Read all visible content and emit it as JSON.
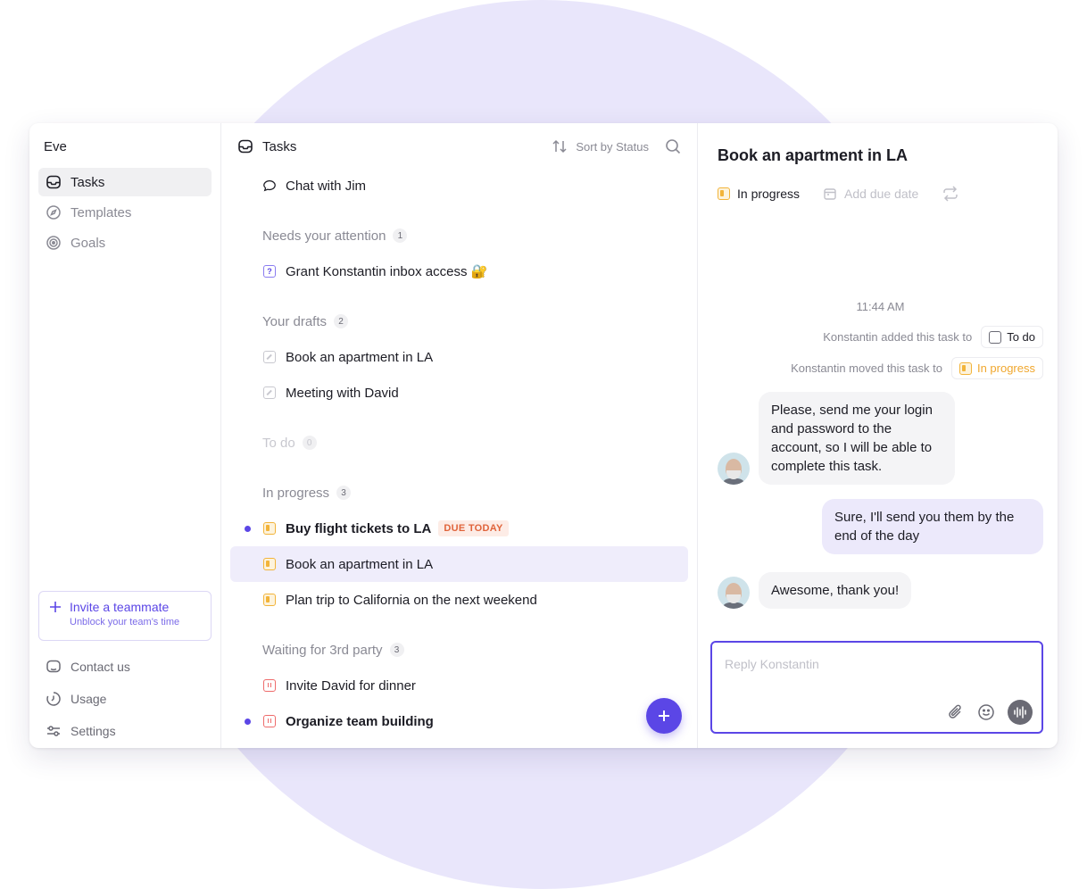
{
  "workspace": "Eve",
  "sidebar": {
    "items": [
      {
        "label": "Tasks",
        "icon": "inbox-icon",
        "active": true
      },
      {
        "label": "Templates",
        "icon": "compass-icon"
      },
      {
        "label": "Goals",
        "icon": "target-icon"
      }
    ],
    "invite": {
      "label": "Invite a teammate",
      "sub": "Unblock your team's time"
    },
    "bottom": [
      {
        "label": "Contact us",
        "icon": "chat-icon"
      },
      {
        "label": "Usage",
        "icon": "clock-icon"
      },
      {
        "label": "Settings",
        "icon": "sliders-icon"
      }
    ]
  },
  "tasks": {
    "title": "Tasks",
    "sort_label": "Sort by Status",
    "chat": "Chat with Jim",
    "sections": [
      {
        "title": "Needs your attention",
        "count": "1",
        "items": [
          {
            "label": "Grant Konstantin inbox access 🔐",
            "status": "question"
          }
        ]
      },
      {
        "title": "Your drafts",
        "count": "2",
        "items": [
          {
            "label": "Book an apartment in LA",
            "status": "draft"
          },
          {
            "label": "Meeting with David",
            "status": "draft"
          }
        ]
      },
      {
        "title": "To do",
        "count": "0",
        "items": []
      },
      {
        "title": "In progress",
        "count": "3",
        "items": [
          {
            "label": "Buy flight tickets to LA",
            "status": "in-progress",
            "badge": "DUE TODAY",
            "unread": true
          },
          {
            "label": "Book an apartment in LA",
            "status": "in-progress",
            "selected": true
          },
          {
            "label": "Plan trip to California on the next weekend",
            "status": "in-progress"
          }
        ]
      },
      {
        "title": "Waiting for 3rd party",
        "count": "3",
        "items": [
          {
            "label": "Invite David for dinner",
            "status": "waiting"
          },
          {
            "label": "Organize team building",
            "status": "waiting",
            "unread": true
          }
        ]
      }
    ]
  },
  "detail": {
    "title": "Book an apartment in LA",
    "status": "In progress",
    "due_date": "Add due date",
    "time": "11:44 AM",
    "activity": [
      {
        "text": "Konstantin added this task to",
        "pill": "To do"
      },
      {
        "text": "Konstantin moved this task to",
        "pill": "In progress"
      }
    ],
    "messages": [
      {
        "from": "other",
        "text": "Please, send me your login and password to the account, so I will be able to complete this task."
      },
      {
        "from": "me",
        "text": "Sure, I'll send you them by the end of the day"
      },
      {
        "from": "other",
        "text": "Awesome, thank you!"
      }
    ],
    "reply_placeholder": "Reply Konstantin"
  },
  "colors": {
    "accent": "#5b46e6",
    "in_progress": "#f2b43a",
    "waiting": "#ee6b6b",
    "due_badge": "#e0643b"
  }
}
